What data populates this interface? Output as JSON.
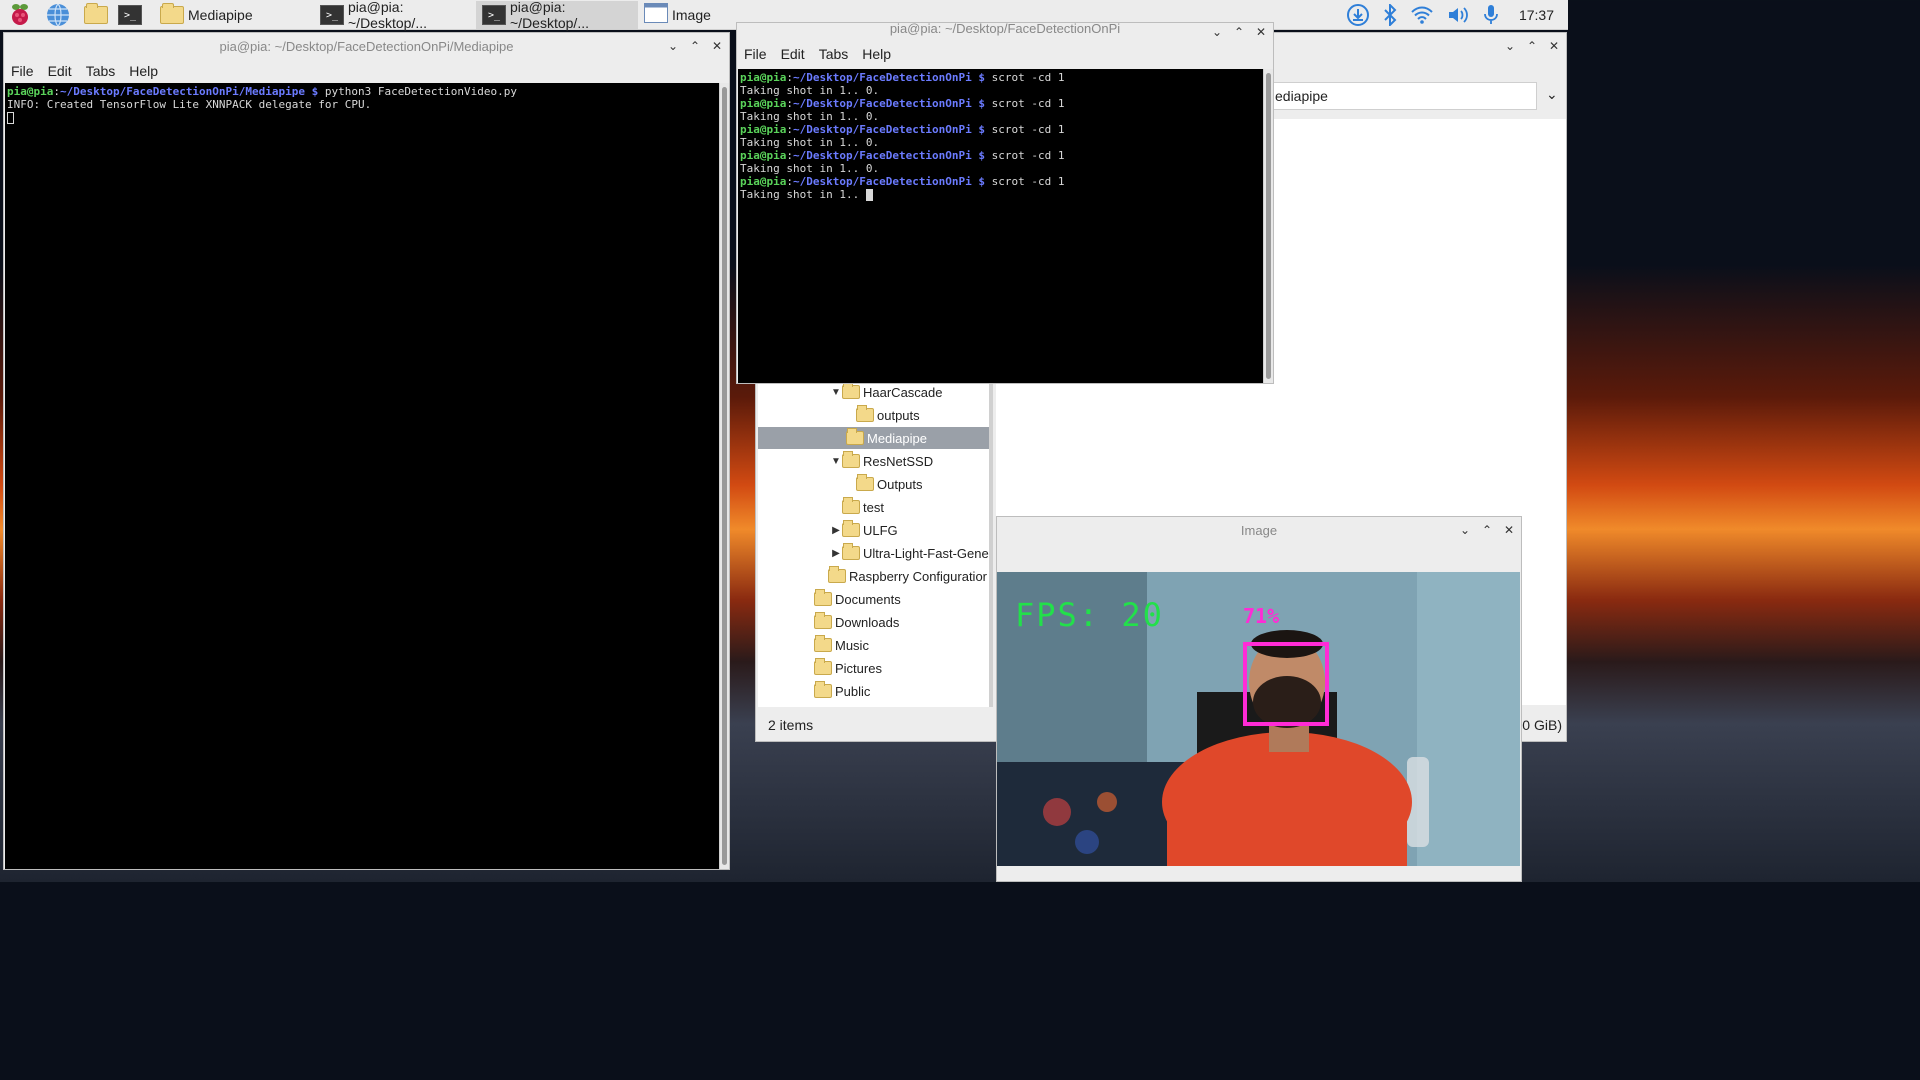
{
  "taskbar": {
    "tasks": [
      {
        "label": "Mediapipe",
        "icon": "folder-icon"
      },
      {
        "label": "pia@pia: ~/Desktop/...",
        "icon": "terminal-icon"
      },
      {
        "label": "pia@pia: ~/Desktop/...",
        "icon": "terminal-icon"
      },
      {
        "label": "Image",
        "icon": "image-window-icon"
      }
    ],
    "clock": "17:37"
  },
  "terminal_left": {
    "title": "pia@pia: ~/Desktop/FaceDetectionOnPi/Mediapipe",
    "menu": [
      "File",
      "Edit",
      "Tabs",
      "Help"
    ],
    "lines": [
      {
        "user": "pia@pia",
        "path": "~/Desktop/FaceDetectionOnPi/Mediapipe $",
        "cmd": "python3 FaceDetectionVideo.py"
      },
      {
        "text": "INFO: Created TensorFlow Lite XNNPACK delegate for CPU."
      }
    ]
  },
  "terminal_right": {
    "title": "pia@pia: ~/Desktop/FaceDetectionOnPi",
    "menu": [
      "File",
      "Edit",
      "Tabs",
      "Help"
    ],
    "prompt_user": "pia@pia",
    "prompt_path": "~/Desktop/FaceDetectionOnPi $",
    "cmd": "scrot -cd 1",
    "output": "Taking shot in 1.. 0.",
    "last_output": "Taking shot in 1.."
  },
  "file_manager": {
    "path_value": "ediapipe",
    "tree": [
      {
        "label": "HaarCascade",
        "expander": "down"
      },
      {
        "label": "outputs",
        "expander": ""
      },
      {
        "label": "Mediapipe",
        "expander": "",
        "selected": true
      },
      {
        "label": "ResNetSSD",
        "expander": "down"
      },
      {
        "label": "Outputs",
        "expander": ""
      },
      {
        "label": "test",
        "expander": ""
      },
      {
        "label": "ULFG",
        "expander": "right"
      },
      {
        "label": "Ultra-Light-Fast-Gene",
        "expander": "right"
      },
      {
        "label": "Raspberry Configuratior",
        "expander": ""
      },
      {
        "label": "Documents",
        "expander": ""
      },
      {
        "label": "Downloads",
        "expander": ""
      },
      {
        "label": "Music",
        "expander": ""
      },
      {
        "label": "Pictures",
        "expander": ""
      },
      {
        "label": "Public",
        "expander": ""
      }
    ],
    "status_items": "2 items",
    "free_space": ".0 GiB)"
  },
  "image_window": {
    "title": "Image",
    "fps_text": "FPS: 20",
    "confidence_text": "71%"
  },
  "colors": {
    "prompt_green": "#5ad35a",
    "prompt_blue": "#6b7bff",
    "overlay_green": "#22e04a",
    "overlay_magenta": "#ff2bd6"
  }
}
